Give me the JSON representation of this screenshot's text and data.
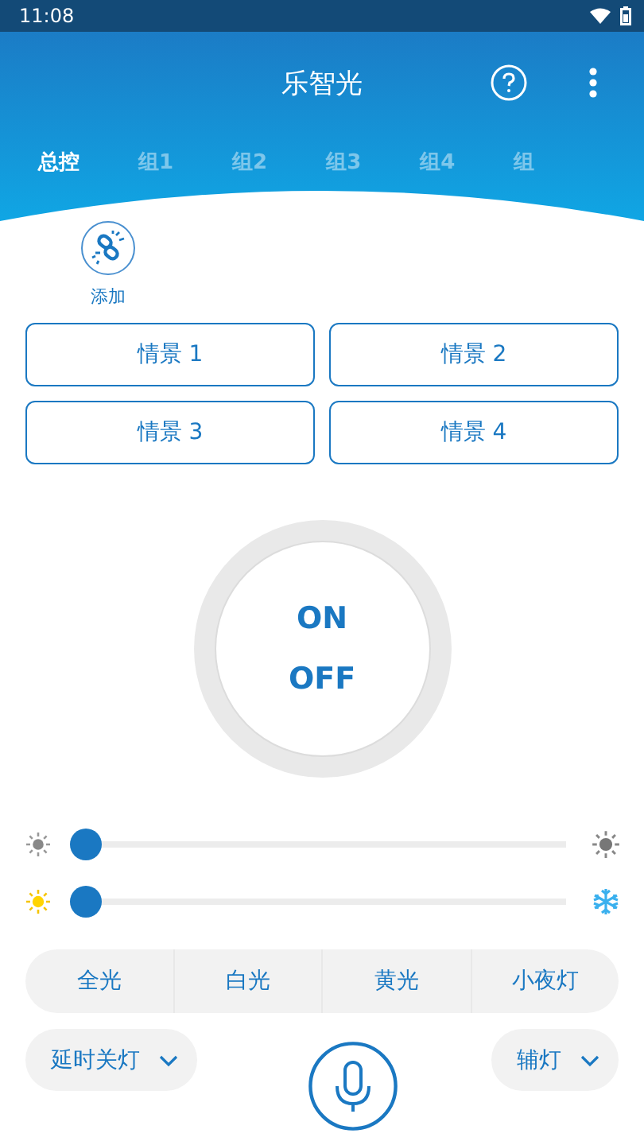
{
  "status_bar": {
    "time": "11:08"
  },
  "header": {
    "title": "乐智光"
  },
  "tabs": [
    {
      "label": "总控",
      "selected": true
    },
    {
      "label": "组1",
      "selected": false
    },
    {
      "label": "组2",
      "selected": false
    },
    {
      "label": "组3",
      "selected": false
    },
    {
      "label": "组4",
      "selected": false
    },
    {
      "label": "组",
      "selected": false
    }
  ],
  "add": {
    "label": "添加"
  },
  "scenes": [
    "情景 1",
    "情景 2",
    "情景 3",
    "情景 4"
  ],
  "power": {
    "on": "ON",
    "off": "OFF"
  },
  "sliders": [
    {
      "kind": "brightness",
      "level": 0
    },
    {
      "kind": "color_temperature",
      "level": 0
    }
  ],
  "modes": [
    "全光",
    "白光",
    "黄光",
    "小夜灯"
  ],
  "dropdowns": [
    {
      "label": "延时关灯"
    },
    {
      "label": "辅灯"
    }
  ]
}
